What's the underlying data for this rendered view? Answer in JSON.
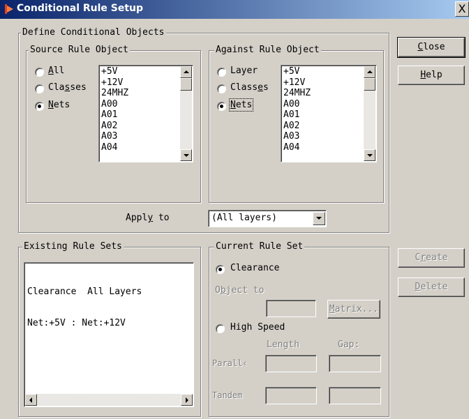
{
  "window": {
    "title": "Conditional Rule Setup",
    "close_symbol": "X"
  },
  "define_group": {
    "legend": "Define Conditional Objects"
  },
  "source_group": {
    "legend": "Source Rule Object",
    "radios": [
      {
        "pre": "",
        "key": "A",
        "post": "ll",
        "checked": false
      },
      {
        "pre": "Cla",
        "key": "s",
        "post": "ses",
        "checked": false
      },
      {
        "pre": "",
        "key": "N",
        "post": "ets",
        "checked": true
      }
    ],
    "list": [
      "+5V",
      "+12V",
      "24MHZ",
      "A00",
      "A01",
      "A02",
      "A03",
      "A04"
    ]
  },
  "against_group": {
    "legend": "Against Rule Object",
    "radios": [
      {
        "pre": "Layer",
        "key": "",
        "post": "",
        "checked": false
      },
      {
        "pre": "Class",
        "key": "e",
        "post": "s",
        "checked": false
      },
      {
        "pre": "",
        "key": "N",
        "post": "ets",
        "checked": true
      }
    ],
    "list": [
      "+5V",
      "+12V",
      "24MHZ",
      "A00",
      "A01",
      "A02",
      "A03",
      "A04"
    ]
  },
  "apply_to": {
    "pre": "Appl",
    "key": "y",
    "post": " to",
    "value": "(All layers)"
  },
  "existing_group": {
    "legend": "Existing Rule Sets",
    "lines": [
      "Clearance  All Layers",
      "Net:+5V : Net:+12V"
    ]
  },
  "current_group": {
    "legend": "Current Rule Set",
    "clearance_label": "Clearance",
    "object_to_pre": "O",
    "object_to_key": "b",
    "object_to_post": "ject to",
    "matrix_key": "M",
    "matrix_post": "atrix...",
    "high_speed_label": "High Speed",
    "length_label": "Length",
    "gap_label": "Gap:",
    "parallel_label": "Parall‹",
    "tandem_label": "Tandem"
  },
  "buttons": {
    "close_key": "C",
    "close_post": "lose",
    "help_key": "H",
    "help_post": "elp",
    "create_pre": "C",
    "create_key": "r",
    "create_post": "eate",
    "delete_key": "D",
    "delete_post": "elete"
  },
  "colors": {
    "title_start": "#0a246a",
    "title_end": "#a6caf0",
    "face": "#d4d0c8"
  }
}
